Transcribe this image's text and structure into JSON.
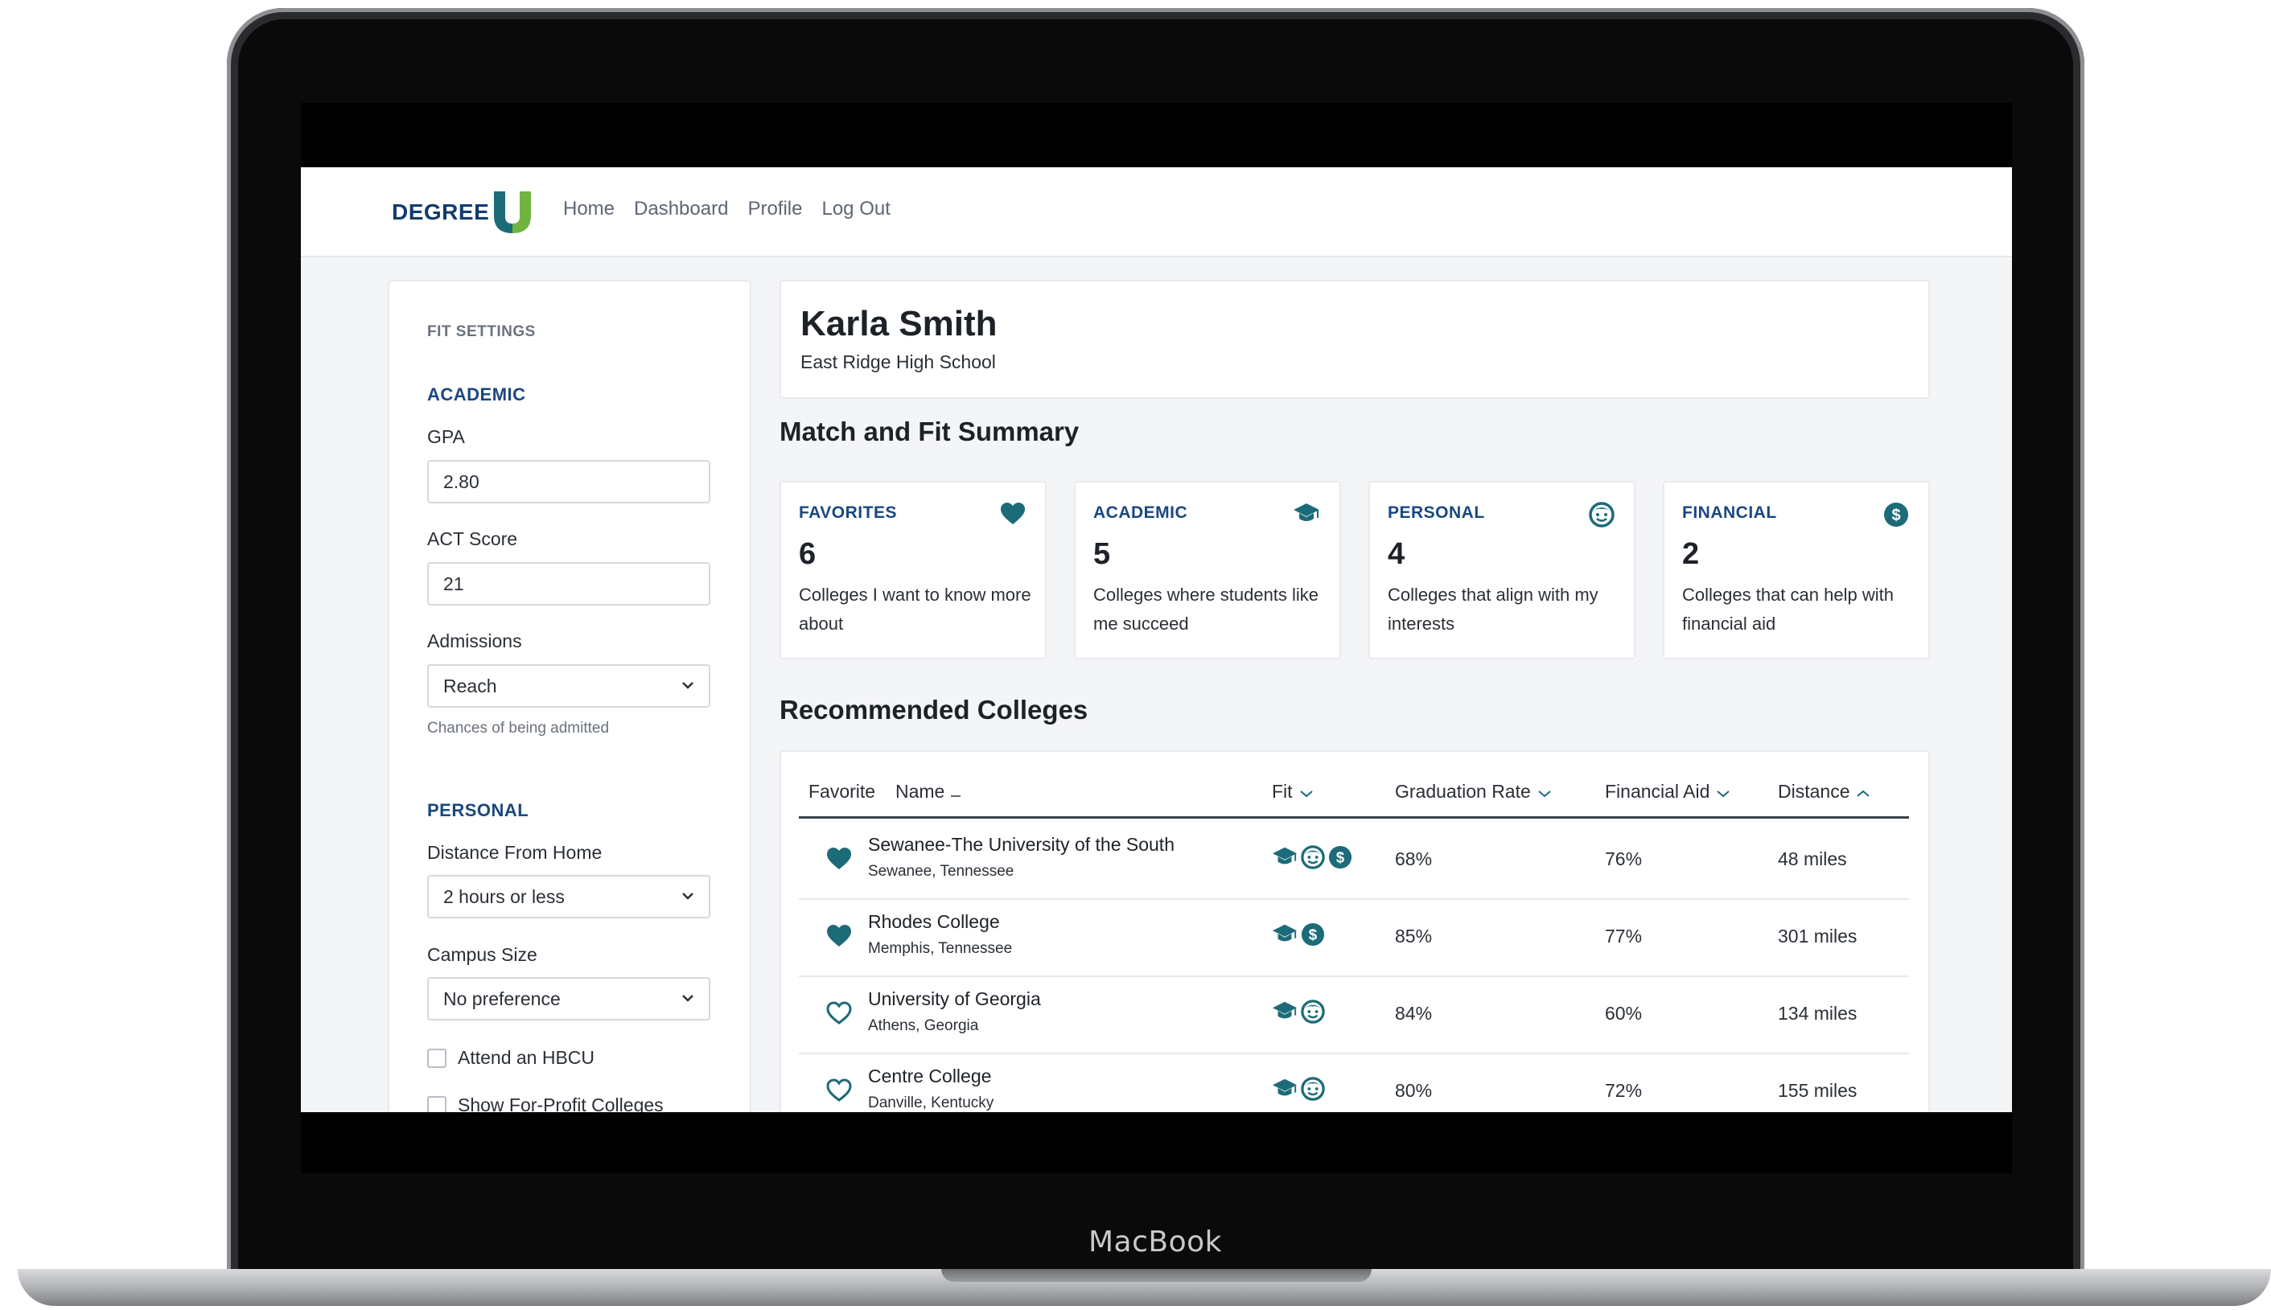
{
  "device": {
    "brand": "MacBook"
  },
  "nav": {
    "logo": "DEGREE",
    "links": [
      "Home",
      "Dashboard",
      "Profile",
      "Log Out"
    ]
  },
  "sidebar": {
    "title": "FIT SETTINGS",
    "academic": {
      "heading": "ACADEMIC",
      "gpa_label": "GPA",
      "gpa_value": "2.80",
      "act_label": "ACT Score",
      "act_value": "21",
      "admissions_label": "Admissions",
      "admissions_value": "Reach",
      "admissions_help": "Chances of being admitted"
    },
    "personal": {
      "heading": "PERSONAL",
      "distance_label": "Distance From Home",
      "distance_value": "2 hours or less",
      "campus_label": "Campus Size",
      "campus_value": "No preference",
      "hbcu_label": "Attend an HBCU",
      "forprofit_label": "Show For-Profit Colleges"
    }
  },
  "profile": {
    "name": "Karla Smith",
    "school": "East Ridge High School"
  },
  "summary": {
    "heading": "Match and Fit Summary",
    "cards": [
      {
        "title": "FAVORITES",
        "icon": "heart-icon",
        "count": "6",
        "desc": "Colleges I want to know more about"
      },
      {
        "title": "ACADEMIC",
        "icon": "graduation-cap-icon",
        "count": "5",
        "desc": "Colleges where students like me succeed"
      },
      {
        "title": "PERSONAL",
        "icon": "smiley-face-icon",
        "count": "4",
        "desc": "Colleges that align with my interests"
      },
      {
        "title": "FINANCIAL",
        "icon": "dollar-icon",
        "count": "2",
        "desc": "Colleges that can help with financial aid"
      }
    ]
  },
  "colleges": {
    "heading": "Recommended Colleges",
    "columns": {
      "favorite": "Favorite",
      "name": "Name",
      "fit": "Fit",
      "grad": "Graduation Rate",
      "aid": "Financial Aid",
      "distance": "Distance"
    },
    "rows": [
      {
        "name": "Sewanee-The University of the South",
        "location": "Sewanee, Tennessee",
        "favorite": true,
        "fit": [
          "academic",
          "personal",
          "financial"
        ],
        "grad": "68%",
        "aid": "76%",
        "distance": "48 miles"
      },
      {
        "name": "Rhodes College",
        "location": "Memphis, Tennessee",
        "favorite": true,
        "fit": [
          "academic",
          "financial"
        ],
        "grad": "85%",
        "aid": "77%",
        "distance": "301 miles"
      },
      {
        "name": "University of Georgia",
        "location": "Athens, Georgia",
        "favorite": false,
        "fit": [
          "academic",
          "personal"
        ],
        "grad": "84%",
        "aid": "60%",
        "distance": "134 miles"
      },
      {
        "name": "Centre College",
        "location": "Danville, Kentucky",
        "favorite": false,
        "fit": [
          "academic",
          "personal"
        ],
        "grad": "80%",
        "aid": "72%",
        "distance": "155 miles"
      }
    ]
  },
  "colors": {
    "accent_teal": "#1c6b78",
    "brand_navy": "#133b6d",
    "section_blue": "#1a4780",
    "logo_green": "#6fb43f",
    "page_bg": "#f4f5f7"
  }
}
